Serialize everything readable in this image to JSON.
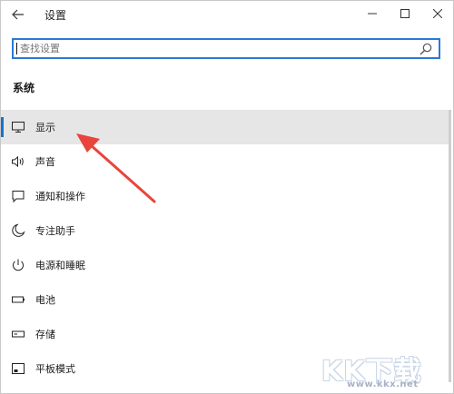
{
  "window": {
    "title": "设置"
  },
  "search": {
    "placeholder": "查找设置",
    "value": ""
  },
  "section": {
    "title": "系统"
  },
  "nav": {
    "items": [
      {
        "label": "显示",
        "icon": "monitor-icon",
        "active": true
      },
      {
        "label": "声音",
        "icon": "speaker-icon",
        "active": false
      },
      {
        "label": "通知和操作",
        "icon": "notification-icon",
        "active": false
      },
      {
        "label": "专注助手",
        "icon": "moon-icon",
        "active": false
      },
      {
        "label": "电源和睡眠",
        "icon": "power-icon",
        "active": false
      },
      {
        "label": "电池",
        "icon": "battery-icon",
        "active": false
      },
      {
        "label": "存储",
        "icon": "storage-icon",
        "active": false
      },
      {
        "label": "平板模式",
        "icon": "tablet-icon",
        "active": false
      }
    ]
  },
  "colors": {
    "accent": "#1a73c8",
    "search_border": "#2b79d8",
    "arrow": "#e8453c",
    "active_bg": "#e6e6e6"
  },
  "watermark": {
    "logo": "KK下载",
    "url": "www.kkx.net"
  }
}
